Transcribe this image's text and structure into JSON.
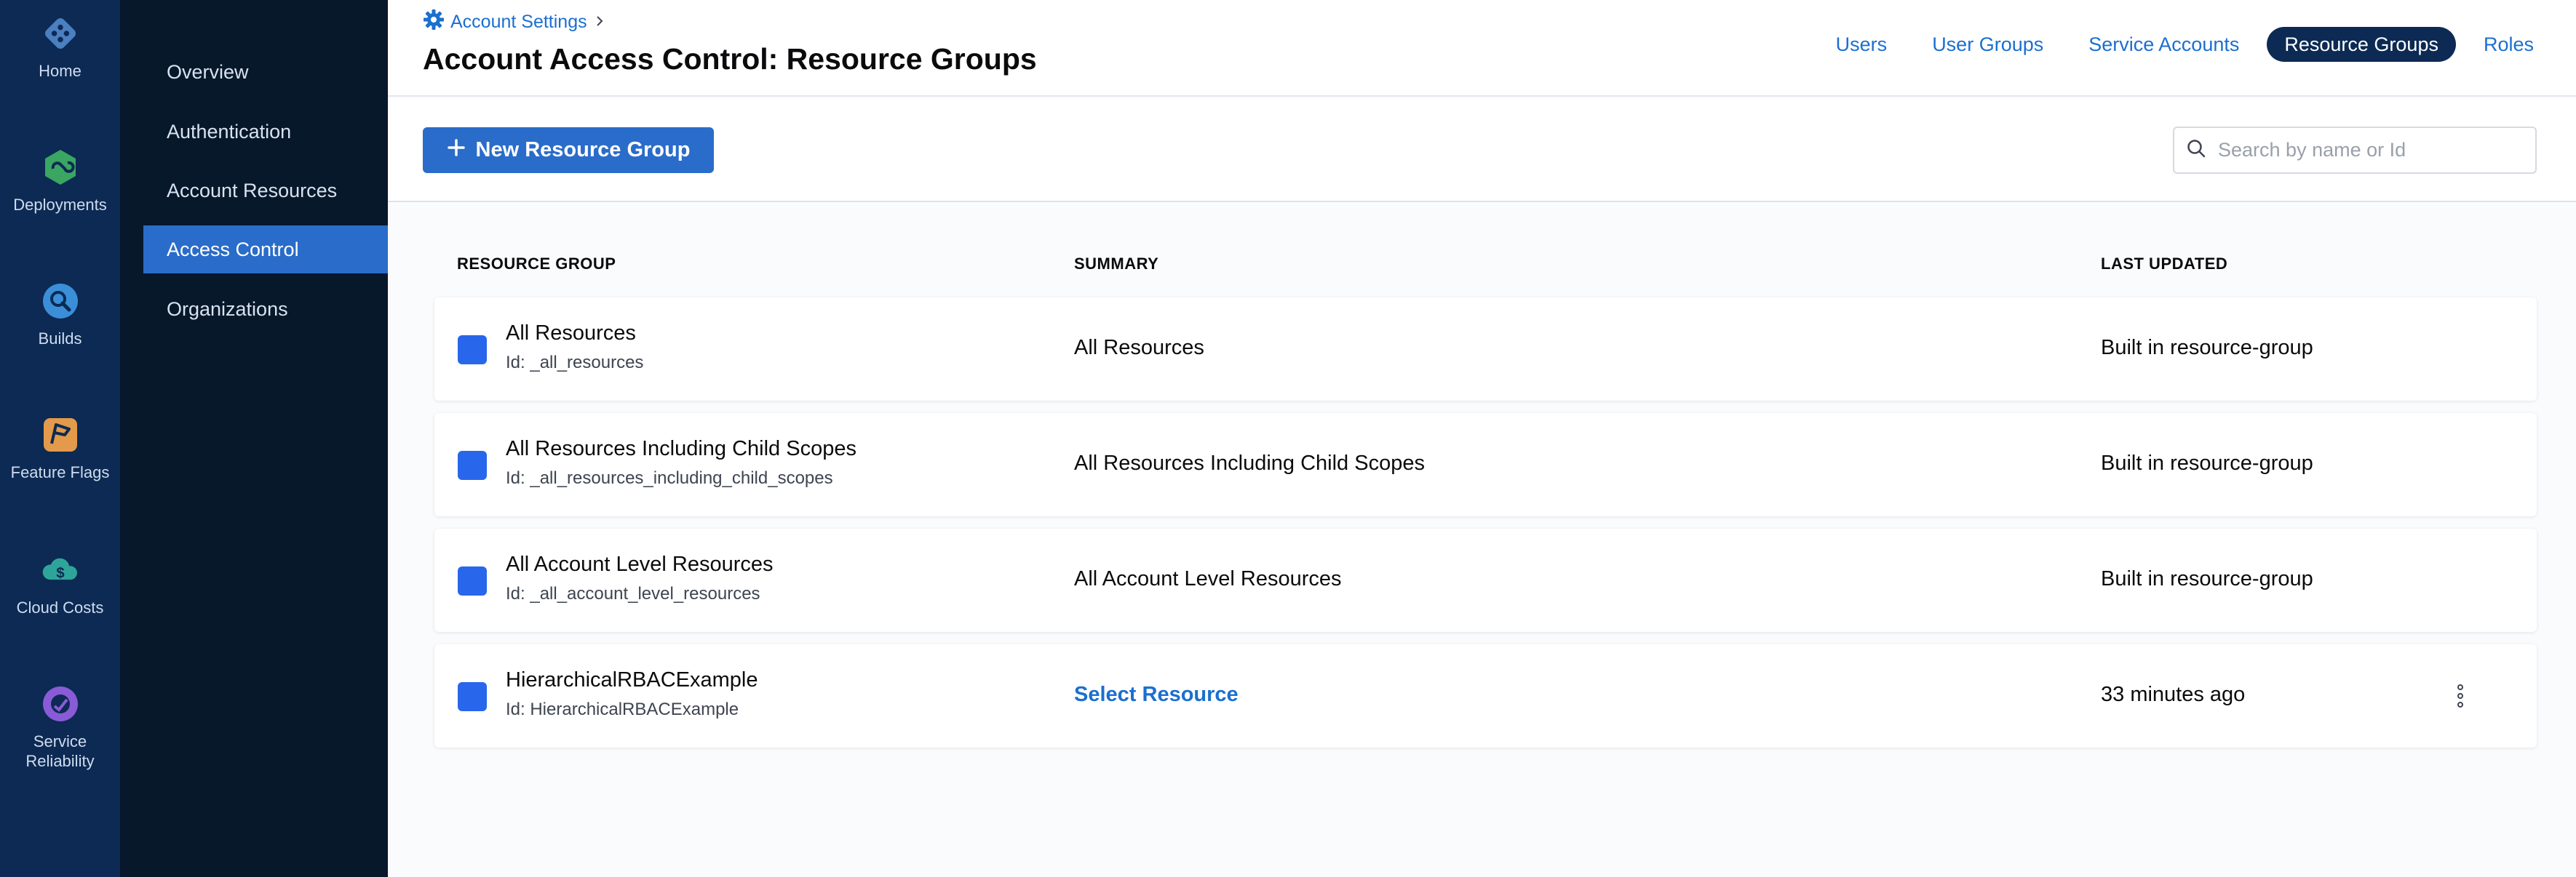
{
  "nav": {
    "items": [
      {
        "label": "Home",
        "icon": "home-icon"
      },
      {
        "label": "Deployments",
        "icon": "deployments-icon"
      },
      {
        "label": "Builds",
        "icon": "builds-icon"
      },
      {
        "label": "Feature Flags",
        "icon": "feature-flags-icon"
      },
      {
        "label": "Cloud Costs",
        "icon": "cloud-costs-icon"
      },
      {
        "label": "Service\nReliability",
        "icon": "service-reliability-icon"
      }
    ]
  },
  "sidebar": {
    "items": [
      {
        "label": "Overview"
      },
      {
        "label": "Authentication"
      },
      {
        "label": "Account Resources"
      },
      {
        "label": "Access Control",
        "active": true
      },
      {
        "label": "Organizations"
      }
    ]
  },
  "header": {
    "breadcrumb": "Account Settings",
    "title": "Account Access Control: Resource Groups",
    "tabs": [
      {
        "label": "Users"
      },
      {
        "label": "User Groups"
      },
      {
        "label": "Service Accounts"
      },
      {
        "label": "Resource Groups",
        "active": true
      },
      {
        "label": "Roles"
      }
    ]
  },
  "toolbar": {
    "new_button_label": "New Resource Group",
    "search_placeholder": "Search by name or Id"
  },
  "table": {
    "columns": [
      "RESOURCE GROUP",
      "SUMMARY",
      "LAST UPDATED"
    ],
    "rows": [
      {
        "name": "All Resources",
        "id": "Id: _all_resources",
        "summary": "All Resources",
        "updated": "Built in resource-group"
      },
      {
        "name": "All Resources Including Child Scopes",
        "id": "Id: _all_resources_including_child_scopes",
        "summary": "All Resources Including Child Scopes",
        "updated": "Built in resource-group"
      },
      {
        "name": "All Account Level Resources",
        "id": "Id: _all_account_level_resources",
        "summary": "All Account Level Resources",
        "updated": "Built in resource-group"
      },
      {
        "name": "HierarchicalRBACExample",
        "id": "Id: HierarchicalRBACExample",
        "summary": "Select Resource",
        "updated": "33 minutes ago"
      }
    ]
  },
  "colors": {
    "nav_bg": "#0c2a53",
    "sidebar_bg": "#07182b",
    "accent": "#2a6cc9",
    "link": "#1b6fd0",
    "checkbox": "#2867ec"
  }
}
